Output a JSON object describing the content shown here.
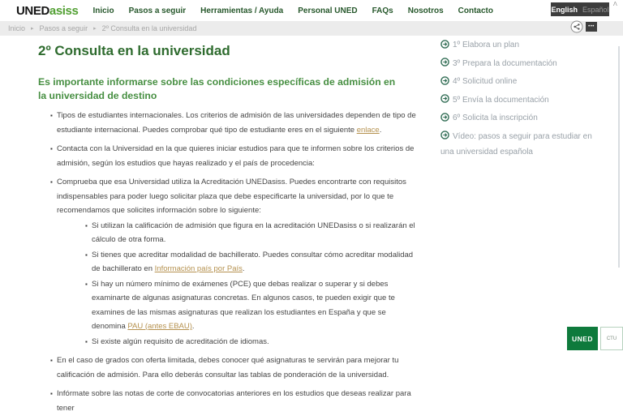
{
  "header": {
    "logo": {
      "uned": "UNED",
      "asiss": "asiss"
    },
    "nav": [
      "Inicio",
      "Pasos a seguir",
      "Herramientas / Ayuda",
      "Personal UNED",
      "FAQs",
      "Nosotros",
      "Contacto"
    ],
    "language": {
      "english": "English",
      "spanish": "Español"
    }
  },
  "breadcrumb": {
    "items": [
      "Inicio",
      "Pasos a seguir",
      "2º Consulta en la universidad"
    ],
    "separator": "▸"
  },
  "icons": {
    "share": "share-nodes-icon",
    "more": "ellipsis-icon",
    "sidebar_bullet": "circle-arrow-right-icon",
    "scroll_up": "chevron-up-icon"
  },
  "main": {
    "title": "2º Consulta en la universidad",
    "subtitle": "Es importante informarse sobre las condiciones específicas de admisión en la universidad de destino",
    "bullets": [
      {
        "segments": [
          {
            "t": "Tipos de estudiantes internacionales. Los criterios de admisión de las universidades dependen de tipo de estudiante internacional. Puedes comprobar qué tipo de estudiante eres en el siguiente "
          },
          {
            "t": "enlace",
            "link": true
          },
          {
            "t": "."
          }
        ]
      },
      {
        "segments": [
          {
            "t": "Contacta con la Universidad en la que quieres iniciar estudios para que te informen sobre los criterios de admisión, según los estudios que hayas realizado y el país de procedencia:"
          }
        ]
      },
      {
        "segments": [
          {
            "t": "Comprueba que esa Universidad utiliza la Acreditación UNEDasiss. Puedes encontrarte con requisitos indispensables para poder luego solicitar plaza que debe especificarte la universidad, por lo que te recomendamos que solicites información sobre lo siguiente:"
          }
        ],
        "children": [
          {
            "segments": [
              {
                "t": "Si utilizan la calificación de admisión que figura en la acreditación UNEDasiss o si realizarán el cálculo de otra forma."
              }
            ]
          },
          {
            "segments": [
              {
                "t": "Si tienes que acreditar modalidad de bachillerato. Puedes consultar cómo acreditar modalidad de bachillerato en "
              },
              {
                "t": "Información país por País",
                "link": true
              },
              {
                "t": "."
              }
            ]
          },
          {
            "segments": [
              {
                "t": "Si hay un número mínimo de exámenes (PCE) que debas realizar o superar y si debes examinarte de algunas asignaturas concretas. En algunos casos, te pueden exigir que te examines de las mismas asignaturas que realizan los estudiantes en España y que se denomina "
              },
              {
                "t": "PAU (antes EBAU)",
                "link": true
              },
              {
                "t": "."
              }
            ]
          },
          {
            "segments": [
              {
                "t": "Si existe algún requisito de acreditación de idiomas."
              }
            ]
          }
        ]
      },
      {
        "segments": [
          {
            "t": "En el caso de grados con oferta limitada, debes conocer qué asignaturas te servirán para mejorar tu calificación de admisión. Para ello deberás consultar las tablas de ponderación de la universidad."
          }
        ]
      },
      {
        "segments": [
          {
            "t": "Infórmate sobre las notas de corte de convocatorias anteriores en los estudios que deseas realizar para tener"
          }
        ]
      }
    ]
  },
  "sidebar": {
    "items": [
      "1º Elabora un plan",
      "3º Prepara la documentación",
      "4º Solicitud online",
      "5º Envía la documentación",
      "6º Solicita la inscripción",
      "Vídeo: pasos a seguir para estudiar en una universidad española"
    ]
  },
  "footer": {
    "uned_badge": "UNED",
    "ctu_badge": "CTU"
  },
  "colors": {
    "nav_green": "#27582c",
    "title_green": "#2e6b2e",
    "subtitle_green": "#478f42",
    "logo_green": "#52a033",
    "link_gold": "#b5914e",
    "badge_green": "#0e7a3c",
    "breadcrumb_bg": "#ececec",
    "lang_box_bg": "#3d3d3d",
    "sidebar_text": "#99a1a8"
  }
}
